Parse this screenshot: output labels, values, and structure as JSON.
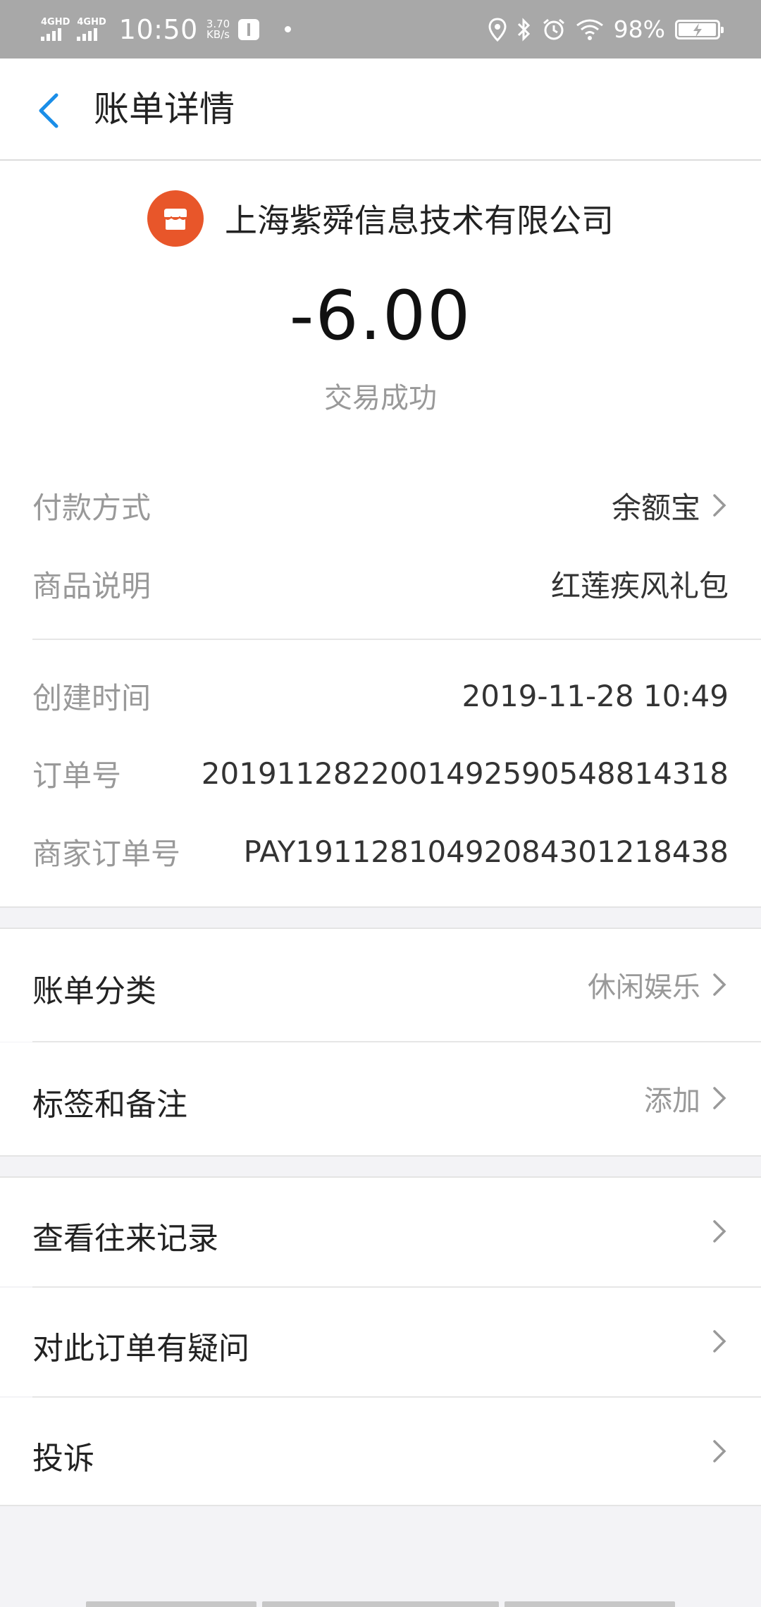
{
  "status_bar": {
    "signal1_label": "4GHD",
    "signal2_label": "4GHD",
    "time": "10:50",
    "speed_value": "3.70",
    "speed_unit": "KB/s",
    "battery_pct": "98%",
    "battery_level": 0.98,
    "icons": [
      "location-icon",
      "bluetooth-icon",
      "alarm-icon",
      "wifi-icon",
      "battery-charging-icon"
    ]
  },
  "nav": {
    "title": "账单详情"
  },
  "merchant": {
    "name": "上海紫舜信息技术有限公司",
    "icon_color": "#e8562a"
  },
  "amount": "-6.00",
  "trade_status": "交易成功",
  "details_group1": [
    {
      "label": "付款方式",
      "value": "余额宝",
      "has_chevron": true
    },
    {
      "label": "商品说明",
      "value": "红莲疾风礼包",
      "has_chevron": false
    }
  ],
  "details_group2": [
    {
      "label": "创建时间",
      "value": "2019-11-28 10:49"
    },
    {
      "label": "订单号",
      "value": "20191128220014925905488143​18"
    },
    {
      "label": "商家订单号",
      "value": "PAY19112810492084301218438"
    }
  ],
  "category_rows": [
    {
      "label": "账单分类",
      "value": "休闲娱乐"
    },
    {
      "label": "标签和备注",
      "value": "添加"
    }
  ],
  "action_rows": [
    {
      "label": "查看往来记录"
    },
    {
      "label": "对此订单有疑问"
    },
    {
      "label": "投诉"
    }
  ],
  "colors": {
    "accent_blue": "#1a8ee8",
    "merchant_orange": "#e8562a",
    "status_bar": "#a8a8a8",
    "background": "#f3f3f6"
  }
}
